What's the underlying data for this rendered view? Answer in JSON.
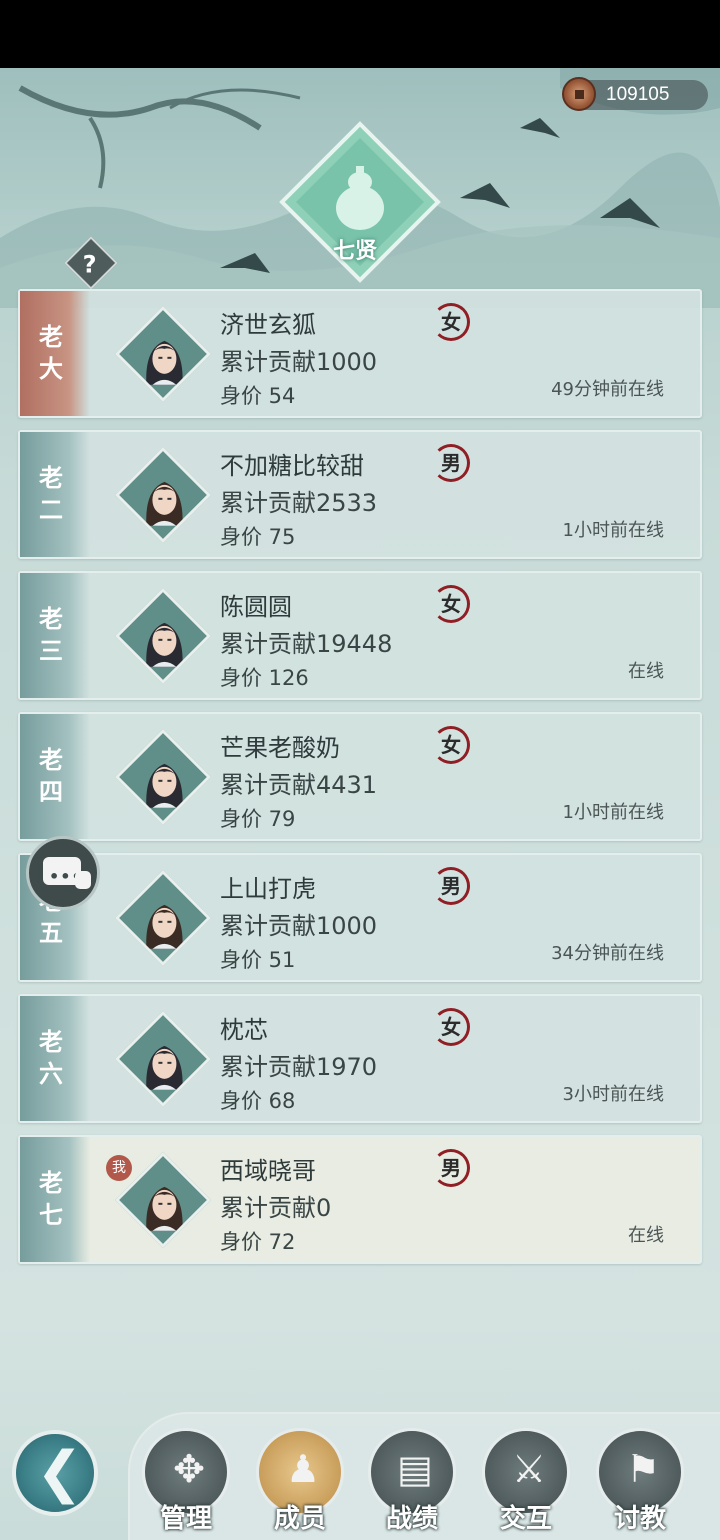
{
  "currency": {
    "icon": "copper-coin-icon",
    "value": "109105"
  },
  "faction": {
    "name": "七贤",
    "emblem_icon": "gourd-diamond-emblem"
  },
  "help": {
    "label": "?"
  },
  "members": [
    {
      "rank": "老大",
      "name": "济世玄狐",
      "gender": "女",
      "contribution": "累计贡献1000",
      "worth": "身价 54",
      "status": "49分钟前在线",
      "is_me": false,
      "avatar": "female-avatar"
    },
    {
      "rank": "老二",
      "name": "不加糖比较甜",
      "gender": "男",
      "contribution": "累计贡献2533",
      "worth": "身价 75",
      "status": "1小时前在线",
      "is_me": false,
      "avatar": "male-avatar"
    },
    {
      "rank": "老三",
      "name": "陈圆圆",
      "gender": "女",
      "contribution": "累计贡献19448",
      "worth": "身价 126",
      "status": "在线",
      "is_me": false,
      "avatar": "female-avatar"
    },
    {
      "rank": "老四",
      "name": "芒果老酸奶",
      "gender": "女",
      "contribution": "累计贡献4431",
      "worth": "身价 79",
      "status": "1小时前在线",
      "is_me": false,
      "avatar": "female-avatar"
    },
    {
      "rank": "老五",
      "name": "上山打虎",
      "gender": "男",
      "contribution": "累计贡献1000",
      "worth": "身价 51",
      "status": "34分钟前在线",
      "is_me": false,
      "avatar": "male-avatar"
    },
    {
      "rank": "老六",
      "name": "枕芯",
      "gender": "女",
      "contribution": "累计贡献1970",
      "worth": "身价 68",
      "status": "3小时前在线",
      "is_me": false,
      "avatar": "female-avatar-dark"
    },
    {
      "rank": "老七",
      "name": "西域晓哥",
      "gender": "男",
      "contribution": "累计贡献0",
      "worth": "身价 72",
      "status": "在线",
      "is_me": true,
      "me_badge": "我",
      "avatar": "male-avatar"
    }
  ],
  "nav": {
    "back_icon": "back-arrow-icon",
    "items": [
      {
        "label": "管理",
        "icon": "manage-icon",
        "glyph": "✥"
      },
      {
        "label": "成员",
        "icon": "members-icon",
        "glyph": "♟"
      },
      {
        "label": "战绩",
        "icon": "record-scroll-icon",
        "glyph": "▤"
      },
      {
        "label": "交互",
        "icon": "crossed-swords-icon",
        "glyph": "⚔"
      },
      {
        "label": "讨教",
        "icon": "challenge-icon",
        "glyph": "⚑"
      }
    ]
  }
}
